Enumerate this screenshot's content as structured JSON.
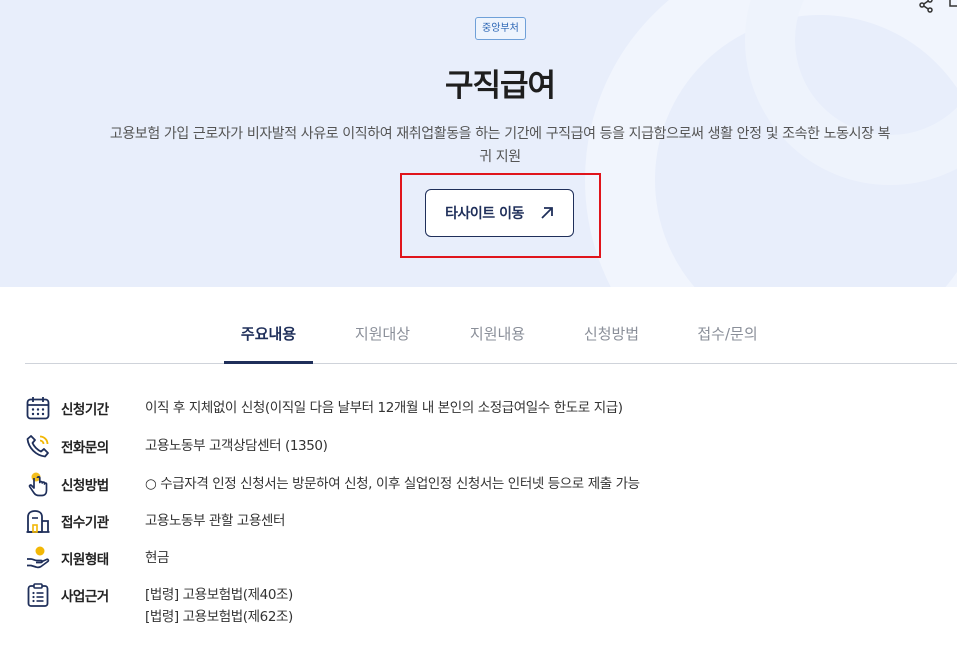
{
  "hero": {
    "badge": "중앙부처",
    "title": "구직급여",
    "description": "고용보험 가입 근로자가 비자발적 사유로 이직하여 재취업활동을 하는 기간에 구직급여 등을 지급함으로써 생활 안정 및 조속한 노동시장 복귀 지원",
    "external_button": "타사이트 이동"
  },
  "tabs": [
    "주요내용",
    "지원대상",
    "지원내용",
    "신청방법",
    "접수/문의"
  ],
  "info": [
    {
      "icon": "calendar-icon",
      "label": "신청기간",
      "value": "이직 후 지체없이 신청(이직일 다음 날부터 12개월 내 본인의 소정급여일수 한도로 지급)"
    },
    {
      "icon": "phone-icon",
      "label": "전화문의",
      "value": "고용노동부 고객상담센터 (1350)"
    },
    {
      "icon": "hand-pointer-icon",
      "label": "신청방법",
      "value": "○ 수급자격 인정 신청서는 방문하여 신청, 이후 실업인정 신청서는 인터넷 등으로 제출 가능"
    },
    {
      "icon": "building-icon",
      "label": "접수기관",
      "value": "고용노동부 관할 고용센터"
    },
    {
      "icon": "hand-coin-icon",
      "label": "지원형태",
      "value": "현금"
    },
    {
      "icon": "clipboard-list-icon",
      "label": "사업근거",
      "values": [
        "[법령] 고용보험법(제40조)",
        "[법령] 고용보험법(제62조)"
      ]
    }
  ],
  "colors": {
    "hero_bg": "#e8eefb",
    "accent_navy": "#1f2f5a",
    "highlight_red": "#e0141b",
    "badge_blue": "#2a65b4"
  }
}
